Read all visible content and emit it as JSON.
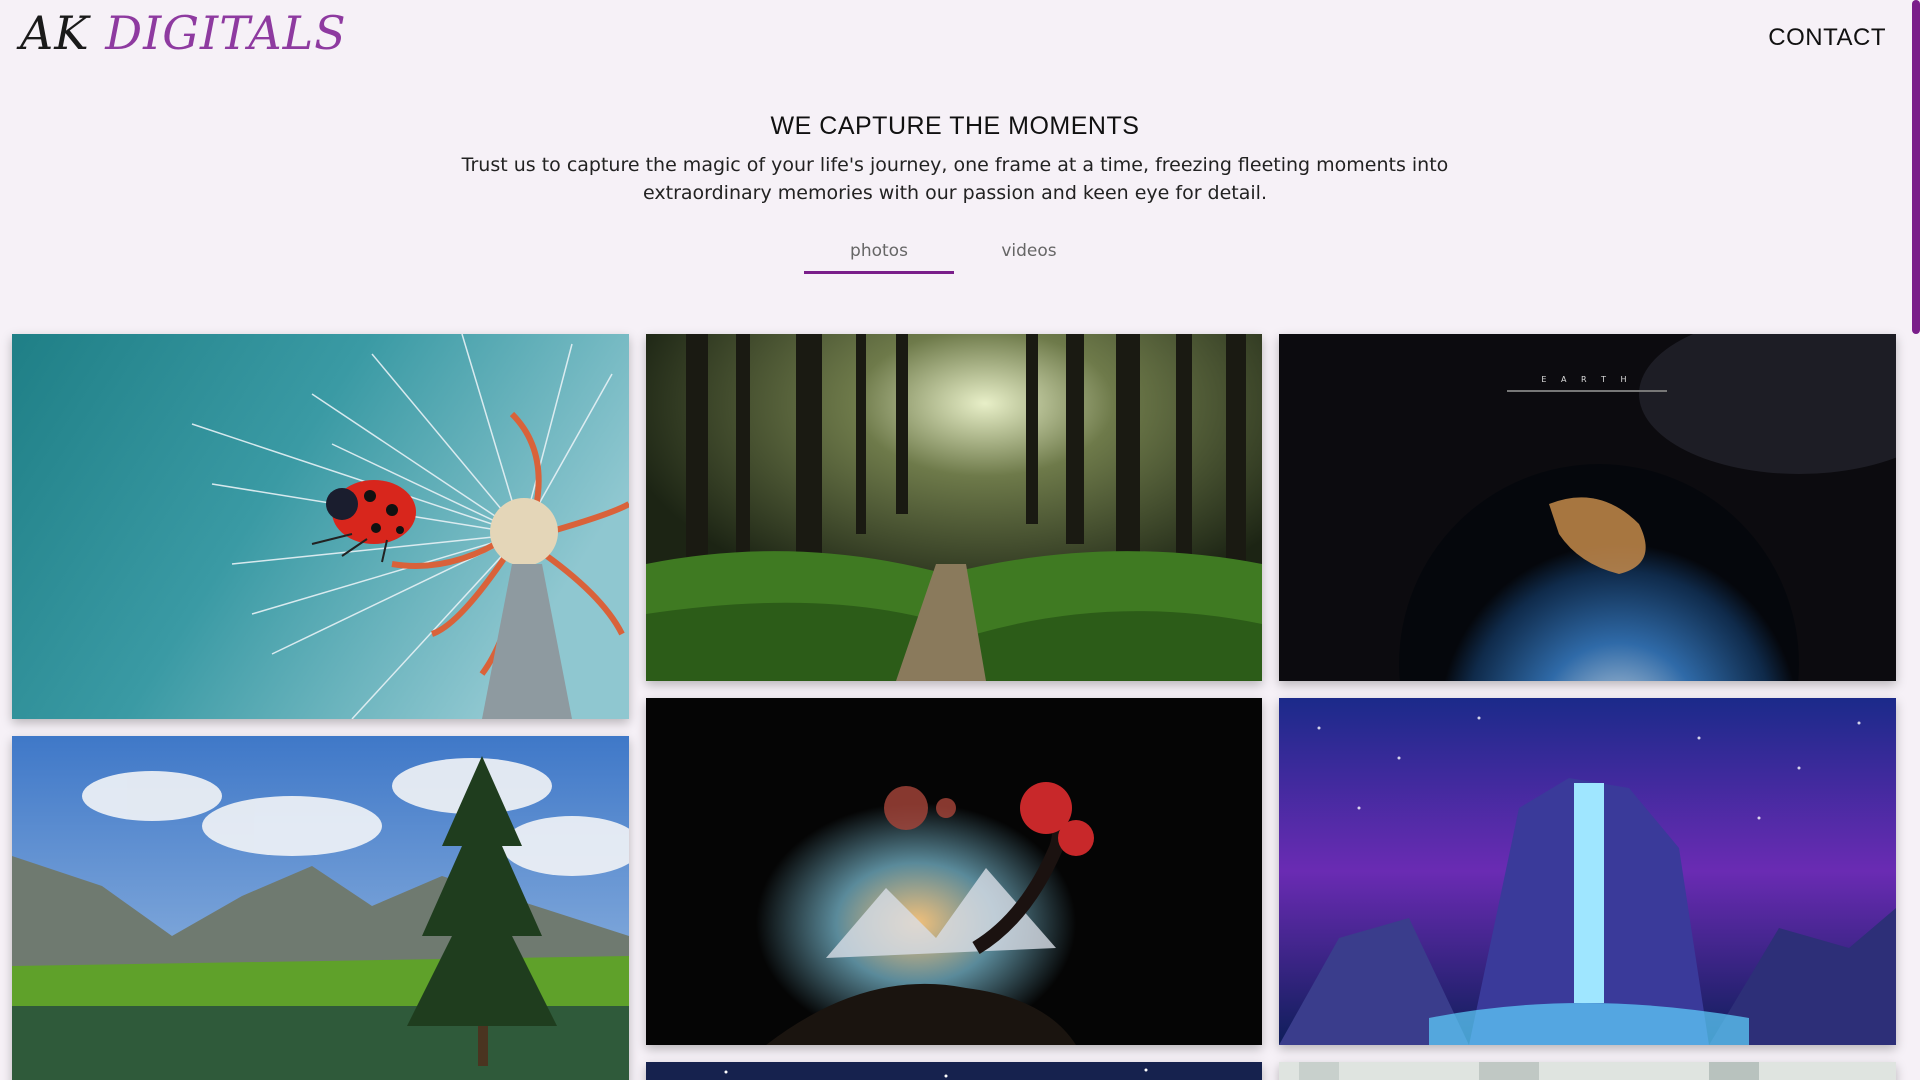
{
  "header": {
    "logo_first": "AK ",
    "logo_second": "DIGITALS",
    "contact_label": "CONTACT"
  },
  "hero": {
    "title": "WE CAPTURE THE MOMENTS",
    "subtitle": "Trust us to capture the magic of your life's journey, one frame at a time, freezing fleeting moments into extraordinary memories with our passion and keen eye for detail."
  },
  "tabs": [
    {
      "label": "photos",
      "active": true
    },
    {
      "label": "videos",
      "active": false
    }
  ],
  "gallery": {
    "photos": [
      {
        "subject": "ladybug on dandelion",
        "caption": ""
      },
      {
        "subject": "forest path",
        "caption": ""
      },
      {
        "subject": "earth from space",
        "caption": "E A R T H"
      },
      {
        "subject": "mountain lake with pine tree",
        "caption": ""
      },
      {
        "subject": "fantasy tree on cliff",
        "caption": ""
      },
      {
        "subject": "neon waterfall",
        "caption": ""
      },
      {
        "subject": "night sky",
        "caption": ""
      },
      {
        "subject": "light scene",
        "caption": ""
      }
    ]
  },
  "colors": {
    "background": "#f6f1f7",
    "accent": "#7a1e8a",
    "logo_accent": "#8e3aa0"
  }
}
